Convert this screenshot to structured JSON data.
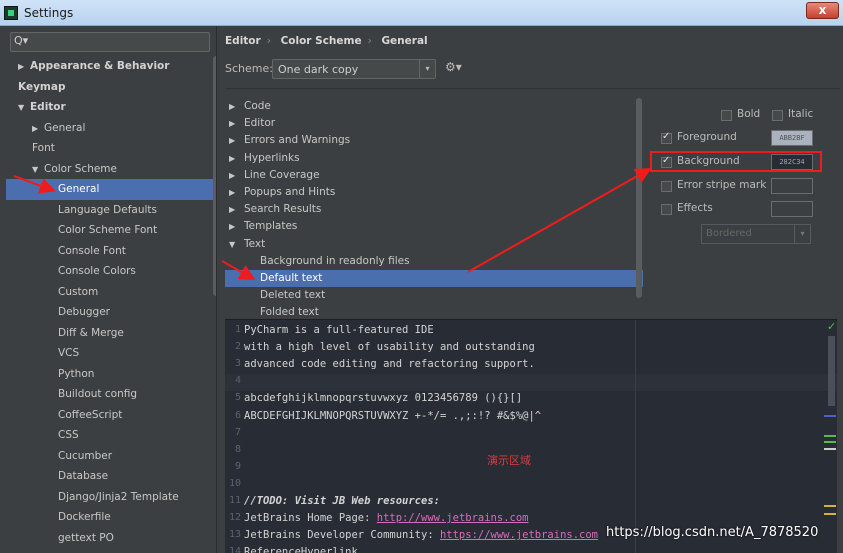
{
  "window": {
    "title": "Settings",
    "close_label": "x"
  },
  "search": {
    "placeholder": "Q▾"
  },
  "sidebar": {
    "items": [
      {
        "label": "Appearance & Behavior",
        "arrow": "▶"
      },
      {
        "label": "Keymap",
        "arrow": ""
      },
      {
        "label": "Editor",
        "arrow": "▼"
      },
      {
        "label": "General",
        "arrow": "▶"
      },
      {
        "label": "Font",
        "arrow": ""
      },
      {
        "label": "Color Scheme",
        "arrow": "▼"
      },
      {
        "label": "General",
        "arrow": ""
      },
      {
        "label": "Language Defaults",
        "arrow": ""
      },
      {
        "label": "Color Scheme Font",
        "arrow": ""
      },
      {
        "label": "Console Font",
        "arrow": ""
      },
      {
        "label": "Console Colors",
        "arrow": ""
      },
      {
        "label": "Custom",
        "arrow": ""
      },
      {
        "label": "Debugger",
        "arrow": ""
      },
      {
        "label": "Diff & Merge",
        "arrow": ""
      },
      {
        "label": "VCS",
        "arrow": ""
      },
      {
        "label": "Python",
        "arrow": ""
      },
      {
        "label": "Buildout config",
        "arrow": ""
      },
      {
        "label": "CoffeeScript",
        "arrow": ""
      },
      {
        "label": "CSS",
        "arrow": ""
      },
      {
        "label": "Cucumber",
        "arrow": ""
      },
      {
        "label": "Database",
        "arrow": ""
      },
      {
        "label": "Django/Jinja2 Template",
        "arrow": ""
      },
      {
        "label": "Dockerfile",
        "arrow": ""
      },
      {
        "label": "gettext PO",
        "arrow": ""
      }
    ]
  },
  "breadcrumb": {
    "items": [
      "Editor",
      "Color Scheme",
      "General"
    ],
    "separator": "›"
  },
  "scheme": {
    "label": "Scheme:",
    "value": "One dark copy",
    "dropdown_arrow": "▾",
    "gear": "⚙▾"
  },
  "tokens": {
    "items": [
      {
        "label": "Code",
        "arrow": "▶"
      },
      {
        "label": "Editor",
        "arrow": "▶"
      },
      {
        "label": "Errors and Warnings",
        "arrow": "▶"
      },
      {
        "label": "Hyperlinks",
        "arrow": "▶"
      },
      {
        "label": "Line Coverage",
        "arrow": "▶"
      },
      {
        "label": "Popups and Hints",
        "arrow": "▶"
      },
      {
        "label": "Search Results",
        "arrow": "▶"
      },
      {
        "label": "Templates",
        "arrow": "▶"
      },
      {
        "label": "Text",
        "arrow": "▼"
      },
      {
        "label": "Background in readonly files",
        "arrow": ""
      },
      {
        "label": "Default text",
        "arrow": ""
      },
      {
        "label": "Deleted text",
        "arrow": ""
      },
      {
        "label": "Folded text",
        "arrow": ""
      }
    ]
  },
  "attributes": {
    "bold_label": "Bold",
    "italic_label": "Italic",
    "foreground_label": "Foreground",
    "foreground_value": "ABB2BF",
    "foreground_color": "#ABB2BF",
    "foreground_checked": true,
    "background_label": "Background",
    "background_value": "282C34",
    "background_color": "#282C34",
    "background_checked": true,
    "error_stripe_label": "Error stripe mark",
    "effects_label": "Effects",
    "effect_type": "Bordered"
  },
  "preview": {
    "lines": [
      {
        "n": "1",
        "text": "PyCharm is a full-featured IDE"
      },
      {
        "n": "2",
        "text": "with a high level of usability and outstanding"
      },
      {
        "n": "3",
        "text": "advanced code editing and refactoring support."
      },
      {
        "n": "4",
        "text": ""
      },
      {
        "n": "5",
        "text": "abcdefghijklmnopqrstuvwxyz 0123456789 (){}[]"
      },
      {
        "n": "6",
        "text": "ABCDEFGHIJKLMNOPQRSTUVWXYZ +-*/= .,;:!? #&$%@|^"
      },
      {
        "n": "7",
        "text": ""
      },
      {
        "n": "8",
        "text": ""
      },
      {
        "n": "9",
        "text": ""
      },
      {
        "n": "10",
        "text": ""
      },
      {
        "n": "11",
        "text": "//TODO: Visit JB Web resources:"
      },
      {
        "n": "12",
        "text": "JetBrains Home Page: ",
        "link": "http://www.jetbrains.com"
      },
      {
        "n": "13",
        "text": "JetBrains Developer Community: ",
        "link": "https://www.jetbrains.com"
      },
      {
        "n": "14",
        "text": "ReferenceHyperlink"
      }
    ],
    "demo_label": "演示区域"
  },
  "watermark": "https://blog.csdn.net/A_7878520",
  "colors": {
    "selection": "#4b6eaf",
    "annotation_red": "#ee1c1c",
    "panel": "#3c3f41",
    "editor_bg": "#282c34"
  }
}
